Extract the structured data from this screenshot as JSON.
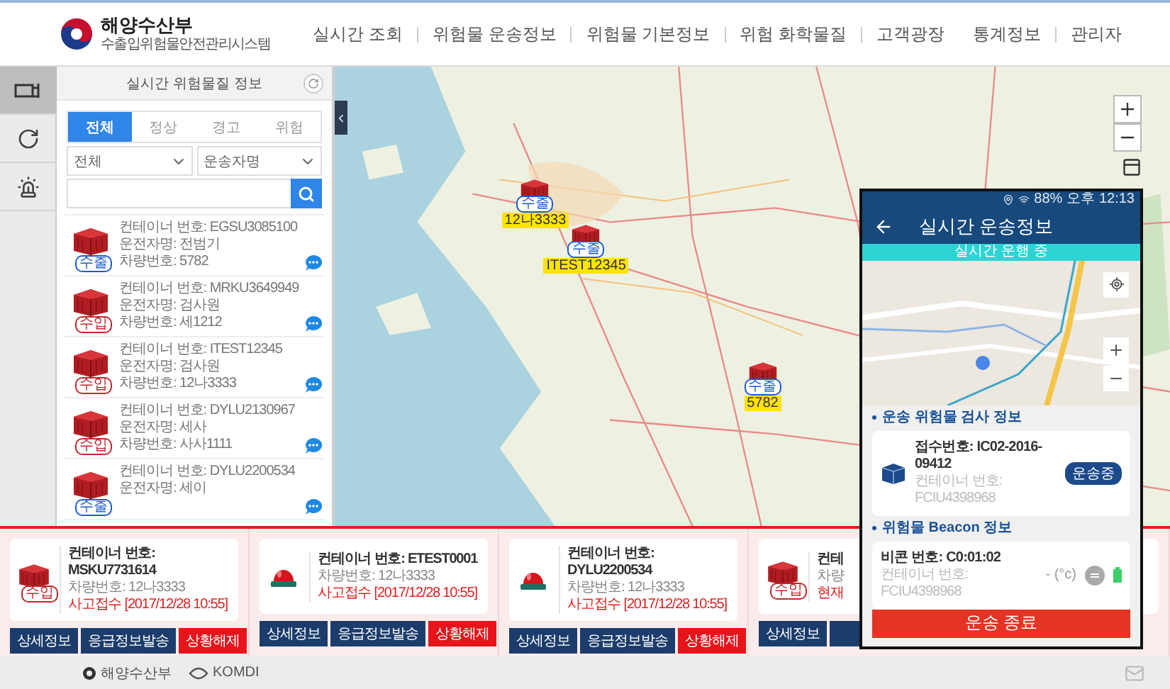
{
  "header": {
    "logo_title": "해양수산부",
    "logo_subtitle": "수출입위험물안전관리시스템",
    "nav": [
      "실시간 조회",
      "위험물 운송정보",
      "위험물 기본정보",
      "위험 화학물질",
      "고객광장"
    ],
    "utility": [
      "통계정보",
      "관리자"
    ]
  },
  "rail": [
    {
      "kind": "container",
      "selected": true
    },
    {
      "kind": "refresh",
      "selected": false
    },
    {
      "kind": "alarm",
      "selected": false
    }
  ],
  "panel": {
    "title": "실시간 위험물질 정보",
    "tabs": [
      {
        "label": "전체",
        "selected": true
      },
      {
        "label": "정상",
        "selected": false
      },
      {
        "label": "경고",
        "selected": false
      },
      {
        "label": "위험",
        "selected": false
      }
    ],
    "filters": [
      "전체",
      "운송자명"
    ],
    "items": [
      {
        "kind": "export",
        "badge": "수출",
        "lines": [
          "컨테이너 번호: EGSU3085100",
          "운전자명: 전범기",
          "차량번호: 5782"
        ]
      },
      {
        "kind": "import",
        "badge": "수입",
        "lines": [
          "컨테이너 번호: MRKU3649949",
          "운전자명: 검사원",
          "차량번호: 세1212"
        ]
      },
      {
        "kind": "import",
        "badge": "수입",
        "lines": [
          "컨테이너 번호: ITEST12345",
          "운전자명: 검사원",
          "차량번호: 12나3333"
        ]
      },
      {
        "kind": "import",
        "badge": "수입",
        "lines": [
          "컨테이너 번호: DYLU2130967",
          "운전자명: 세사",
          "차량번호: 사사1111"
        ]
      },
      {
        "kind": "export",
        "badge": "수출",
        "lines": [
          "컨테이너 번호: DYLU2200534",
          "운전자명: 세이"
        ]
      }
    ]
  },
  "map": {
    "markers": [
      {
        "badge": "수출",
        "label": "12나3333"
      },
      {
        "badge": "수출",
        "label": "ITEST12345"
      },
      {
        "badge": "수출",
        "label": "5782"
      }
    ]
  },
  "alerts": [
    {
      "kind": "container",
      "badge": "수입",
      "title": "컨테이너 번호: MSKU7731614",
      "vehicle": "차량번호: 12나3333",
      "status": "사고접수 [2017/12/28 10:55]",
      "buttons": [
        {
          "kind": "info",
          "label": "상세정보"
        },
        {
          "kind": "info",
          "label": "응급정보발송"
        },
        {
          "kind": "release",
          "label": "상황해제"
        }
      ]
    },
    {
      "kind": "siren",
      "title": "컨테이너 번호: ETEST0001",
      "vehicle": "차량번호: 12나3333",
      "status": "사고접수 [2017/12/28 10:55]",
      "buttons": [
        {
          "kind": "info",
          "label": "상세정보"
        },
        {
          "kind": "info",
          "label": "응급정보발송"
        },
        {
          "kind": "release",
          "label": "상황해제"
        }
      ]
    },
    {
      "kind": "siren",
      "title": "컨테이너 번호: DYLU2200534",
      "vehicle": "차량번호: 12나3333",
      "status": "사고접수 [2017/12/28 10:55]",
      "buttons": [
        {
          "kind": "info",
          "label": "상세정보"
        },
        {
          "kind": "info",
          "label": "응급정보발송"
        },
        {
          "kind": "release",
          "label": "상황해제"
        }
      ]
    },
    {
      "kind": "container",
      "badge": "수입",
      "title": "컨테",
      "vehicle": "차량",
      "status": "현재",
      "buttons": [
        {
          "kind": "info",
          "label": "상세정보"
        },
        {
          "kind": "info"
        }
      ]
    }
  ],
  "phone": {
    "battery": "88%",
    "time": "오후 12:13",
    "title": "실시간 운송정보",
    "banner": "실시간 운행 중",
    "inspection": {
      "heading": "운송 위험물 검사 정보",
      "receipt": "접수번호: IC02-2016-09412",
      "container": "컨테이너 번호: FCIU4398968",
      "badge": "운송중"
    },
    "beacon": {
      "heading": "위험물 Beacon 정보",
      "id": "비콘 번호: C0:01:02",
      "container": "컨테이너 번호: FCIU4398968",
      "temperature": "- (°c)"
    },
    "end_button": "운송 종료"
  },
  "footer": {
    "logos": [
      "해양수산부",
      "KOMDI"
    ]
  }
}
